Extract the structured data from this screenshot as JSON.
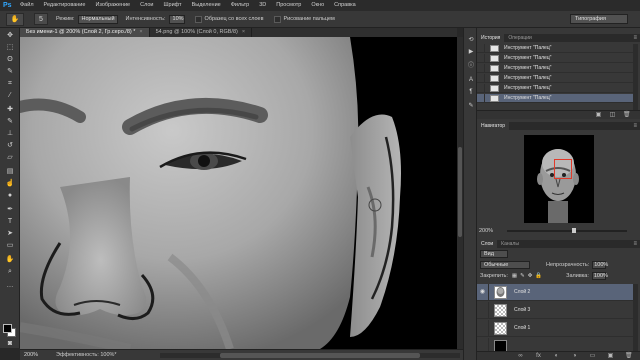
{
  "menubar": {
    "logo": "Ps",
    "items": [
      "Файл",
      "Редактирование",
      "Изображение",
      "Слои",
      "Шрифт",
      "Выделение",
      "Фильтр",
      "3D",
      "Просмотр",
      "Окно",
      "Справка"
    ]
  },
  "options": {
    "tool_icon": "✋",
    "brush_size": "5",
    "mode_label": "Режим:",
    "mode_value": "Нормальный",
    "strength_label": "Интенсивность:",
    "strength_value": "10%",
    "sample_all": "Образец со всех слоев",
    "finger_paint": "Рисование пальцем",
    "workspace": "Типография"
  },
  "tabs": [
    {
      "label": "Без имени-1 @ 200% (Слой 2, Гр.серо./8) *",
      "close": "×"
    },
    {
      "label": "54.png @ 100% (Слой 0, RGB/8)",
      "close": "×"
    }
  ],
  "status": {
    "zoom": "200%",
    "info": "Эффективность: 100%*"
  },
  "history": {
    "tabs": [
      "История",
      "Операции"
    ],
    "rows": [
      "Инструмент \"Палец\"",
      "Инструмент \"Палец\"",
      "Инструмент \"Палец\"",
      "Инструмент \"Палец\"",
      "Инструмент \"Палец\"",
      "Инструмент \"Палец\""
    ],
    "selected_index": 5
  },
  "navigator": {
    "title": "Навигатор",
    "zoom": "200%"
  },
  "layers": {
    "tabs": [
      "Слои",
      "Каналы"
    ],
    "kind_label": "Вид",
    "blend_mode": "Обычные",
    "opacity_label": "Непрозрачность:",
    "opacity_value": "100%",
    "lock_label": "Закрепить:",
    "fill_label": "Заливка:",
    "fill_value": "100%",
    "items": [
      {
        "name": "Слой 2",
        "selected": true,
        "visible": true,
        "thumb": "face"
      },
      {
        "name": "Слой 3",
        "selected": false,
        "visible": false,
        "thumb": "checker"
      },
      {
        "name": "Слой 1",
        "selected": false,
        "visible": false,
        "thumb": "checker"
      },
      {
        "name": "",
        "selected": false,
        "visible": false,
        "thumb": "dark"
      }
    ]
  },
  "colors": {
    "accent": "#596479",
    "nav_rect": "#e23a2a",
    "ps_blue": "#31a8ff"
  }
}
